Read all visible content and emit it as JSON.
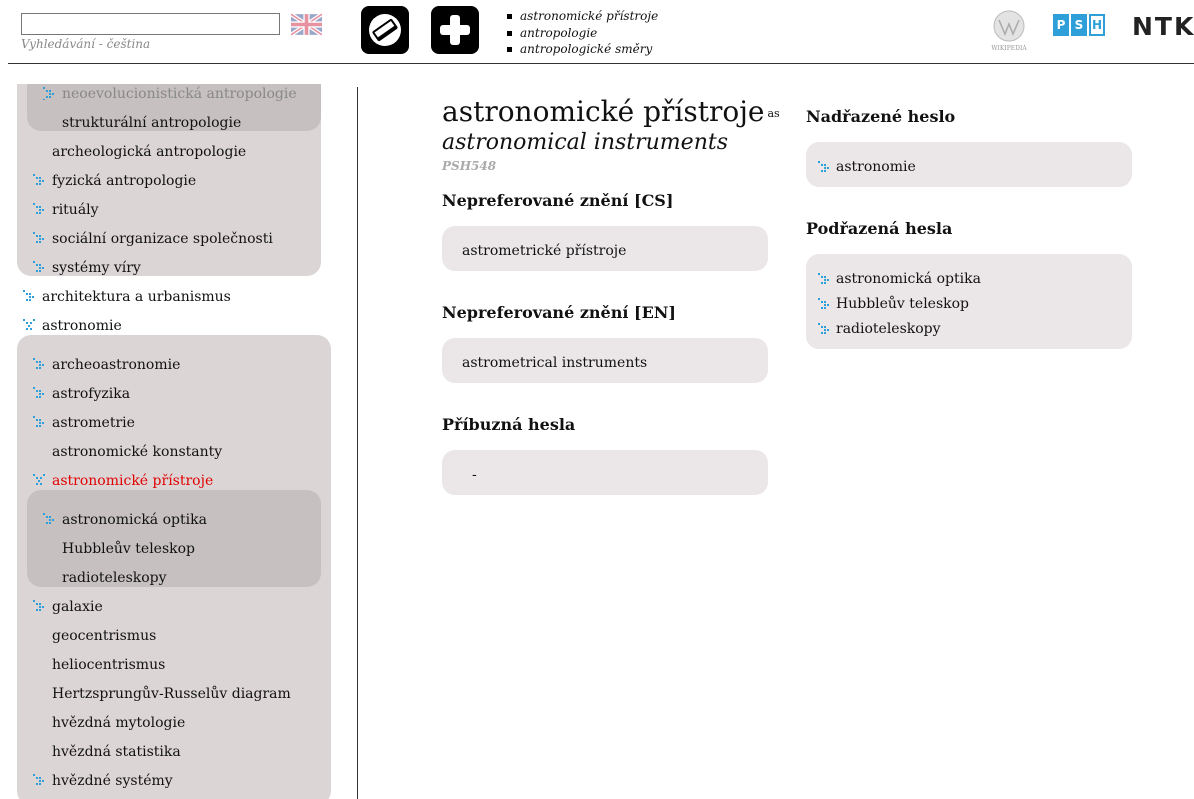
{
  "header": {
    "search": {
      "value": "",
      "hint": "Vyhledávání - čeština"
    },
    "history": [
      "astronomické přístroje",
      "antropologie",
      "antropologické směry"
    ],
    "logos": {
      "wiki": "WIKIPEDIA",
      "psh": [
        "P",
        "S",
        "H"
      ],
      "ntk": "NTK"
    }
  },
  "sidebar": {
    "items": [
      {
        "label": "neoevolucionistická antropologie",
        "arrow": true
      },
      {
        "label": "strukturální antropologie",
        "arrow": false
      },
      {
        "label": "archeologická antropologie",
        "arrow": false
      },
      {
        "label": "fyzická antropologie",
        "arrow": true
      },
      {
        "label": "rituály",
        "arrow": true
      },
      {
        "label": "sociální organizace společnosti",
        "arrow": true
      },
      {
        "label": "systémy víry",
        "arrow": true
      },
      {
        "label": "architektura a urbanismus",
        "arrow": true
      },
      {
        "label": "astronomie",
        "arrow": true
      },
      {
        "label": "archeoastronomie",
        "arrow": true
      },
      {
        "label": "astrofyzika",
        "arrow": true
      },
      {
        "label": "astrometrie",
        "arrow": true
      },
      {
        "label": "astronomické konstanty",
        "arrow": false
      },
      {
        "label": "astronomické přístroje",
        "arrow": true
      },
      {
        "label": "astronomická optika",
        "arrow": true
      },
      {
        "label": "Hubbleův teleskop",
        "arrow": false
      },
      {
        "label": "radioteleskopy",
        "arrow": false
      },
      {
        "label": "galaxie",
        "arrow": true
      },
      {
        "label": "geocentrismus",
        "arrow": false
      },
      {
        "label": "heliocentrismus",
        "arrow": false
      },
      {
        "label": "Hertzsprungův-Russelův diagram",
        "arrow": false
      },
      {
        "label": "hvězdná mytologie",
        "arrow": false
      },
      {
        "label": "hvězdná statistika",
        "arrow": false
      },
      {
        "label": "hvězdné systémy",
        "arrow": true
      }
    ]
  },
  "term": {
    "title": "astronomické přístroje",
    "lang_badge": "as",
    "english": "astronomical instruments",
    "id": "PSH548"
  },
  "sections": {
    "nonpref_cs": {
      "heading": "Nepreferované znění [CS]",
      "value": "astrometrické přístroje"
    },
    "nonpref_en": {
      "heading": "Nepreferované znění [EN]",
      "value": "astrometrical instruments"
    },
    "related": {
      "heading": "Příbuzná hesla",
      "value": "-"
    },
    "broader": {
      "heading": "Nadřazené heslo",
      "items": [
        "astronomie"
      ]
    },
    "narrower": {
      "heading": "Podřazená hesla",
      "items": [
        "astronomická optika",
        "Hubbleův teleskop",
        "radioteleskopy"
      ]
    }
  },
  "colors": {
    "active": "#e00000",
    "arrow": "#2e9fd8",
    "group_light": "#dcd5d6",
    "group_dark": "#c6c0c1",
    "box": "#ebe7e8"
  }
}
